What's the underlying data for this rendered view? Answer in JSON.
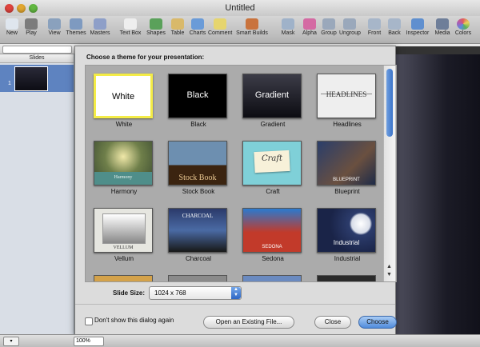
{
  "window": {
    "title": "Untitled"
  },
  "toolbar": [
    {
      "id": "new",
      "label": "New",
      "icon": "new-icon"
    },
    {
      "id": "play",
      "label": "Play",
      "icon": "play-icon"
    },
    {
      "id": "view",
      "label": "View",
      "icon": "view-icon"
    },
    {
      "id": "themes",
      "label": "Themes",
      "icon": "themes-icon"
    },
    {
      "id": "masters",
      "label": "Masters",
      "icon": "masters-icon"
    },
    {
      "id": "textbox",
      "label": "Text Box",
      "icon": "textbox-icon"
    },
    {
      "id": "shapes",
      "label": "Shapes",
      "icon": "shapes-icon"
    },
    {
      "id": "table",
      "label": "Table",
      "icon": "table-icon"
    },
    {
      "id": "charts",
      "label": "Charts",
      "icon": "charts-icon"
    },
    {
      "id": "comment",
      "label": "Comment",
      "icon": "comment-icon"
    },
    {
      "id": "smartbuilds",
      "label": "Smart Builds",
      "icon": "smartbuilds-icon"
    },
    {
      "id": "mask",
      "label": "Mask",
      "icon": "mask-icon"
    },
    {
      "id": "alpha",
      "label": "Alpha",
      "icon": "alpha-icon"
    },
    {
      "id": "group",
      "label": "Group",
      "icon": "group-icon"
    },
    {
      "id": "ungroup",
      "label": "Ungroup",
      "icon": "ungroup-icon"
    },
    {
      "id": "front",
      "label": "Front",
      "icon": "front-icon"
    },
    {
      "id": "back",
      "label": "Back",
      "icon": "back-icon"
    },
    {
      "id": "inspector",
      "label": "Inspector",
      "icon": "inspector-icon"
    },
    {
      "id": "media",
      "label": "Media",
      "icon": "media-icon"
    },
    {
      "id": "colors",
      "label": "Colors",
      "icon": "colors-icon"
    }
  ],
  "slides_panel": {
    "header": "Slides",
    "slide_number": "1"
  },
  "sheet": {
    "heading": "Choose a theme for your presentation:",
    "themes": [
      {
        "name": "White",
        "thumb_text": "White",
        "selected": true
      },
      {
        "name": "Black",
        "thumb_text": "Black",
        "selected": false
      },
      {
        "name": "Gradient",
        "thumb_text": "Gradient",
        "selected": false
      },
      {
        "name": "Headlines",
        "thumb_text": "HEADLINES",
        "selected": false
      },
      {
        "name": "Harmony",
        "thumb_text": "Harmony",
        "selected": false
      },
      {
        "name": "Stock Book",
        "thumb_text": "Stock Book",
        "selected": false
      },
      {
        "name": "Craft",
        "thumb_text": "Craft",
        "selected": false
      },
      {
        "name": "Blueprint",
        "thumb_text": "BLUEPRINT",
        "selected": false
      },
      {
        "name": "Vellum",
        "thumb_text": "VELLUM",
        "selected": false
      },
      {
        "name": "Charcoal",
        "thumb_text": "CHARCOAL",
        "selected": false
      },
      {
        "name": "Sedona",
        "thumb_text": "SEDONA",
        "selected": false
      },
      {
        "name": "Industrial",
        "thumb_text": "Industrial",
        "selected": false
      }
    ],
    "slide_size_label": "Slide Size:",
    "slide_size_value": "1024 x 768",
    "dont_show_label": "Don't show this dialog again",
    "dont_show_checked": false,
    "open_existing_label": "Open an Existing File...",
    "close_label": "Close",
    "choose_label": "Choose"
  },
  "bottom_bar": {
    "zoom": "100%"
  },
  "colors": {
    "accent": "#4f8bdb",
    "selection": "#f4ec46"
  }
}
